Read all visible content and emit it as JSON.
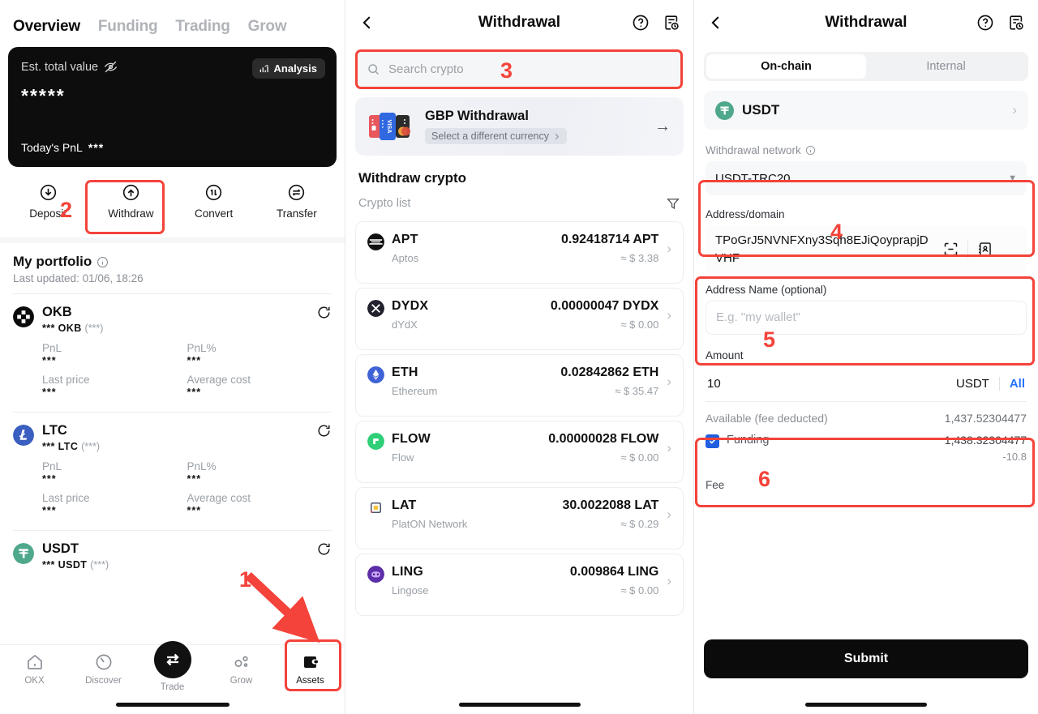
{
  "panel1": {
    "tabs": [
      {
        "label": "Overview",
        "active": true
      },
      {
        "label": "Funding",
        "active": false
      },
      {
        "label": "Trading",
        "active": false
      },
      {
        "label": "Grow",
        "active": false
      }
    ],
    "balance": {
      "label": "Est. total value",
      "value": "*****",
      "pnl_label": "Today's PnL",
      "pnl_value": "***",
      "analysis_label": "Analysis"
    },
    "actions": [
      {
        "label": "Deposit",
        "icon": "download-circle-icon"
      },
      {
        "label": "Withdraw",
        "icon": "upload-circle-icon"
      },
      {
        "label": "Convert",
        "icon": "convert-circle-icon"
      },
      {
        "label": "Transfer",
        "icon": "transfer-circle-icon"
      }
    ],
    "portfolio": {
      "title": "My portfolio",
      "last_updated": "Last updated: 01/06, 18:26",
      "metric_labels": {
        "pnl": "PnL",
        "pnl_pct": "PnL%",
        "last_price": "Last price",
        "avg_cost": "Average cost"
      },
      "coins": [
        {
          "symbol": "OKB",
          "amount": "***",
          "unit": "OKB",
          "paren": "(***)",
          "pnl": "***",
          "pnl_pct": "***",
          "last_price": "***",
          "avg_cost": "***",
          "color": "#0b0b0b"
        },
        {
          "symbol": "LTC",
          "amount": "***",
          "unit": "LTC",
          "paren": "(***)",
          "pnl": "***",
          "pnl_pct": "***",
          "last_price": "***",
          "avg_cost": "***",
          "color": "#3a5fc0"
        },
        {
          "symbol": "USDT",
          "amount": "***",
          "unit": "USDT",
          "paren": "(***)",
          "color": "#4fa88b"
        }
      ]
    },
    "bottom_nav": [
      {
        "label": "OKX",
        "icon": "home-icon",
        "active": false
      },
      {
        "label": "Discover",
        "icon": "compass-icon",
        "active": false
      },
      {
        "label": "Trade",
        "icon": "trade-swap-icon",
        "active": false
      },
      {
        "label": "Grow",
        "icon": "grow-nodes-icon",
        "active": false
      },
      {
        "label": "Assets",
        "icon": "wallet-icon",
        "active": true
      }
    ]
  },
  "panel2": {
    "header": {
      "title": "Withdrawal",
      "back": "back-icon",
      "help": "help-icon",
      "history": "history-icon"
    },
    "search": {
      "placeholder": "Search crypto"
    },
    "gbp_card": {
      "title": "GBP Withdrawal",
      "chip": "Select a different currency"
    },
    "section_title": "Withdraw crypto",
    "list_label": "Crypto list",
    "cryptos": [
      {
        "symbol": "APT",
        "name": "Aptos",
        "amount": "0.92418714 APT",
        "usd": "≈ $ 3.38",
        "color": "#111111"
      },
      {
        "symbol": "DYDX",
        "name": "dYdX",
        "amount": "0.00000047 DYDX",
        "usd": "≈ $ 0.00",
        "color": "#22222e"
      },
      {
        "symbol": "ETH",
        "name": "Ethereum",
        "amount": "0.02842862 ETH",
        "usd": "≈ $ 35.47",
        "color": "#3f63d6"
      },
      {
        "symbol": "FLOW",
        "name": "Flow",
        "amount": "0.00000028 FLOW",
        "usd": "≈ $ 0.00",
        "color": "#2ecf77"
      },
      {
        "symbol": "LAT",
        "name": "PlatON Network",
        "amount": "30.0022088 LAT",
        "usd": "≈ $ 0.29",
        "color": "#f2f3f5"
      },
      {
        "symbol": "LING",
        "name": "Lingose",
        "amount": "0.009864 LING",
        "usd": "≈ $ 0.00",
        "color": "#5c2ea8"
      }
    ]
  },
  "panel3": {
    "header": {
      "title": "Withdrawal",
      "back": "back-icon",
      "help": "help-icon",
      "history": "history-icon"
    },
    "segments": [
      {
        "label": "On-chain",
        "active": true
      },
      {
        "label": "Internal",
        "active": false
      }
    ],
    "coin": {
      "name": "USDT"
    },
    "network": {
      "label": "Withdrawal network",
      "value": "USDT-TRC20"
    },
    "address": {
      "label": "Address/domain",
      "value": "TPoGrJ5NVNFXny3Sqh8EJiQoyprapjDVHF"
    },
    "address_name": {
      "label": "Address Name (optional)",
      "placeholder": "E.g. \"my wallet\""
    },
    "amount": {
      "label": "Amount",
      "value": "10",
      "unit": "USDT",
      "all_label": "All"
    },
    "available": {
      "label": "Available (fee deducted)",
      "value": "1,437.52304477"
    },
    "funding": {
      "label": "Funding",
      "value": "1,438.32304477",
      "delta": "-10.8",
      "checked": true
    },
    "fee": {
      "label": "Fee"
    },
    "submit": {
      "label": "Submit"
    },
    "accent_link": "#2573ff",
    "accent_checkbox": "#1f5fe0"
  },
  "annotations": {
    "color": "#f4433a",
    "steps": [
      "1",
      "2",
      "3",
      "4",
      "5",
      "6"
    ]
  }
}
